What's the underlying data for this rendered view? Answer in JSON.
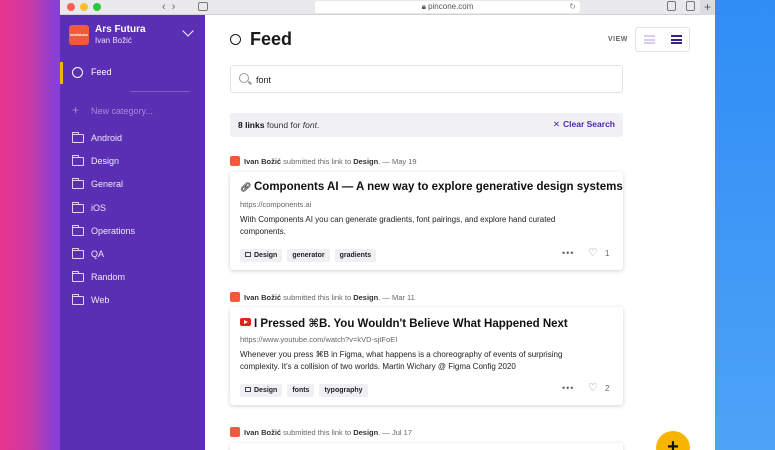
{
  "browser": {
    "url": "pincone.com",
    "colors": {
      "close": "#ff5f57",
      "minimize": "#febc2e",
      "maximize": "#28c840"
    }
  },
  "sidebar": {
    "org_name": "Ars Futura",
    "user_name": "Ivan Božić",
    "logo_text": "arsfutura",
    "feed_label": "Feed",
    "new_category_label": "New category...",
    "categories": [
      "Android",
      "Design",
      "General",
      "iOS",
      "Operations",
      "QA",
      "Random",
      "Web"
    ]
  },
  "main": {
    "title": "Feed",
    "view_label": "VIEW",
    "search": {
      "value": "font"
    },
    "results": {
      "count": "8 links",
      "middle": " found for ",
      "query": "font",
      "end": ".",
      "clear_label": "Clear Search"
    },
    "posts": [
      {
        "author": "Ivan Božić",
        "submitted_text": " submitted this link to ",
        "category": "Design",
        "date": ". — May 19",
        "title": "Components AI — A new way to explore generative design systems",
        "url": "https://components.ai",
        "description": "With Components AI you can generate gradients, font pairings, and explore hand curated components.",
        "tags": [
          "Design",
          "generator",
          "gradients"
        ],
        "likes": "1"
      },
      {
        "author": "Ivan Božić",
        "submitted_text": " submitted this link to ",
        "category": "Design",
        "date": ". — Mar 11",
        "title": "I Pressed ⌘B. You Wouldn't Believe What Happened Next",
        "url": "https://www.youtube.com/watch?v=kVD-sjtFoEI",
        "description": "Whenever you press ⌘B in Figma, what happens is a choreography of events of surprising complexity. It's a collision of two worlds. Martin Wichary @ Figma Config 2020",
        "tags": [
          "Design",
          "fonts",
          "typography"
        ],
        "likes": "2"
      },
      {
        "author": "Ivan Božić",
        "submitted_text": " submitted this link to ",
        "category": "Design",
        "date": ". — Jul 17"
      }
    ],
    "fab_label": "+"
  },
  "colors": {
    "sidebar_bg": "#5b2fb3",
    "accent": "#f7b500",
    "link": "#4b2aa8"
  }
}
